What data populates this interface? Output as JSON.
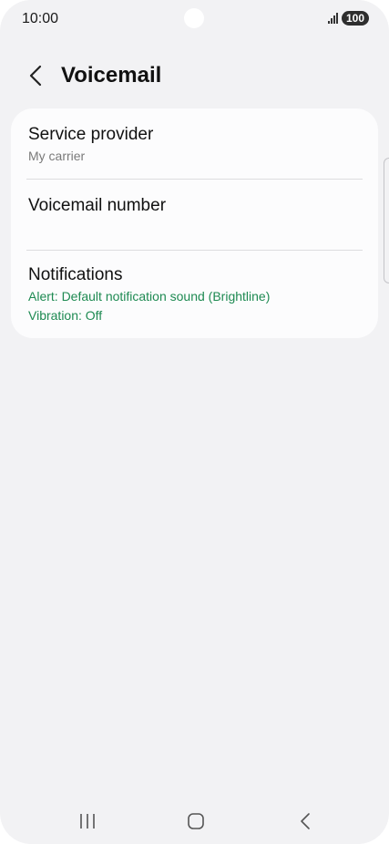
{
  "status_bar": {
    "time": "10:00",
    "battery": "100"
  },
  "header": {
    "title": "Voicemail"
  },
  "settings": {
    "service_provider": {
      "title": "Service provider",
      "subtitle": "My carrier"
    },
    "voicemail_number": {
      "title": "Voicemail number"
    },
    "notifications": {
      "title": "Notifications",
      "alert": "Alert: Default notification sound (Brightline)",
      "vibration": "Vibration: Off"
    }
  },
  "colors": {
    "background": "#f2f2f4",
    "card": "#fcfcfd",
    "accent_green": "#1e8a52"
  },
  "nav_bar": {
    "icons": [
      "recents-icon",
      "home-icon",
      "back-icon"
    ]
  }
}
